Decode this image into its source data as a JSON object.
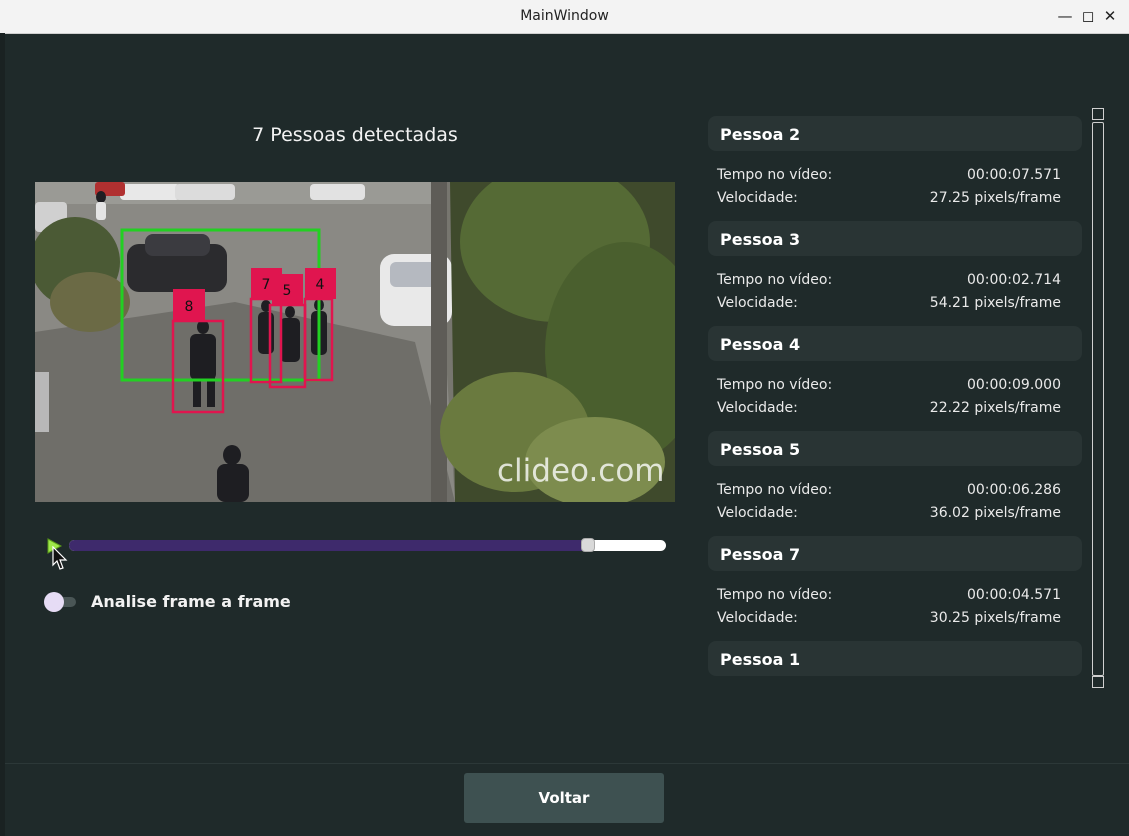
{
  "window": {
    "title": "MainWindow"
  },
  "main": {
    "heading": "7 Pessoas detectadas",
    "video": {
      "watermark": "clideo.com",
      "detections": [
        "8",
        "7",
        "5",
        "4"
      ]
    },
    "slider": {
      "progress": 0.87
    },
    "toggle": {
      "label": "Analise frame a frame",
      "checked": false
    },
    "back_button": "Voltar"
  },
  "panel": {
    "time_label": "Tempo no vídeo:",
    "speed_label": "Velocidade:",
    "people": [
      {
        "name": "Pessoa 2",
        "time": "00:00:07.571",
        "speed": "27.25 pixels/frame"
      },
      {
        "name": "Pessoa 3",
        "time": "00:00:02.714",
        "speed": "54.21 pixels/frame"
      },
      {
        "name": "Pessoa 4",
        "time": "00:00:09.000",
        "speed": "22.22 pixels/frame"
      },
      {
        "name": "Pessoa 5",
        "time": "00:00:06.286",
        "speed": "36.02 pixels/frame"
      },
      {
        "name": "Pessoa 7",
        "time": "00:00:04.571",
        "speed": "30.25 pixels/frame"
      },
      {
        "name": "Pessoa 1"
      }
    ]
  },
  "colors": {
    "background": "#1f2a2a",
    "card": "#293434",
    "slider_fill": "#3e2a6c",
    "detection_box": "#e0154f",
    "region_box": "#22d022",
    "button": "#3e5151"
  }
}
